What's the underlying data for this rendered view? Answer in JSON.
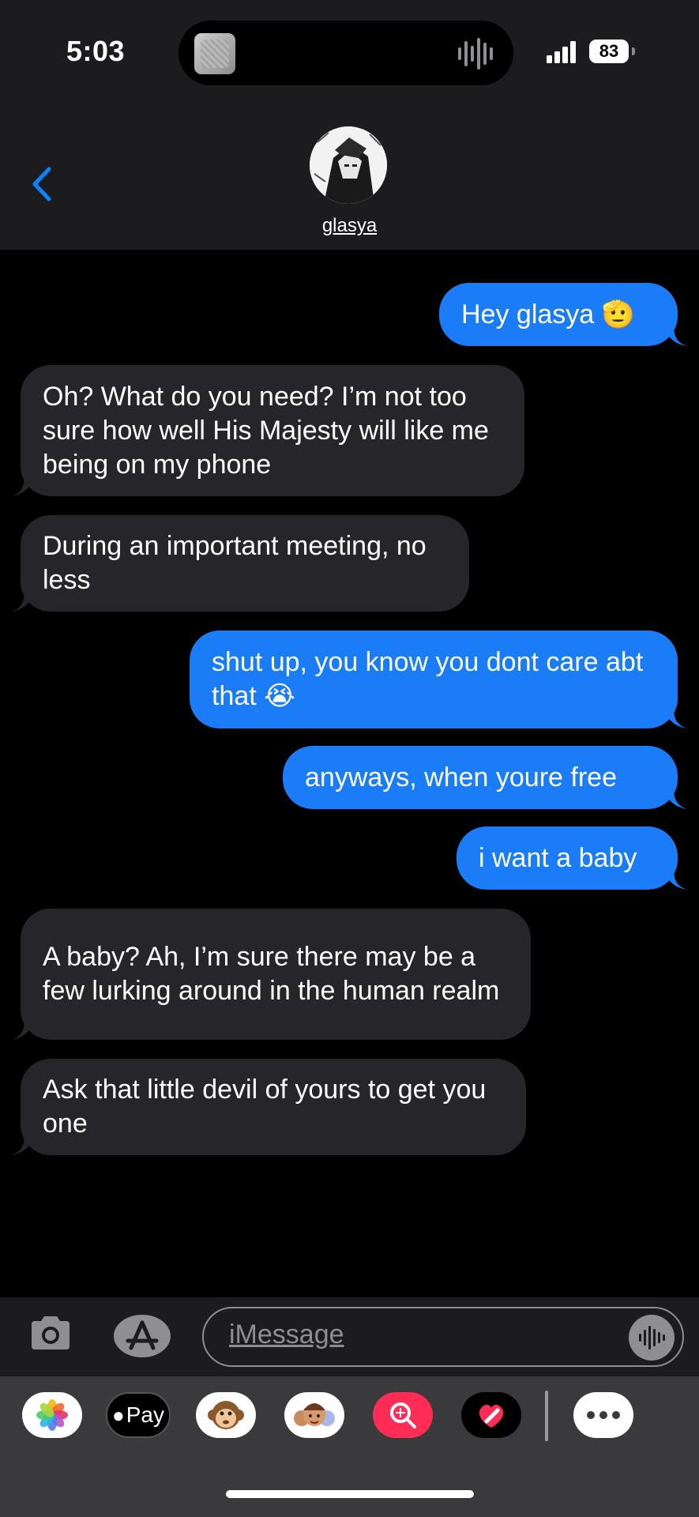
{
  "status_bar": {
    "time": "5:03",
    "battery": "83"
  },
  "contact": {
    "name": "glasya"
  },
  "messages": [
    {
      "side": "sent",
      "text": "Hey glasya 🫡"
    },
    {
      "side": "received",
      "text": "Oh? What do you need? I’m not too sure how well His Majesty will like me being on my phone"
    },
    {
      "side": "received",
      "text": "During an important meeting, no less"
    },
    {
      "side": "sent",
      "text": "shut up, you know you dont care abt that 😭"
    },
    {
      "side": "sent",
      "text": "anyways, when youre free"
    },
    {
      "side": "sent",
      "text": "i want a baby"
    },
    {
      "side": "received",
      "text": "A baby? Ah, I’m sure there may be a few lurking around in the human realm"
    },
    {
      "side": "received",
      "text": "Ask that little devil of yours to get you one"
    }
  ],
  "composer": {
    "placeholder": "iMessage"
  },
  "app_tray": {
    "apple_pay_label": "Pay",
    "apps": [
      "photos-icon",
      "apple-pay-icon",
      "animoji-icon",
      "memoji-icon",
      "image-search-icon",
      "digital-touch-icon",
      "more-icon"
    ]
  },
  "colors": {
    "sent": "#1a7cf6",
    "received": "#26262a",
    "header": "#1c1c1e",
    "back_accent": "#0a84ff"
  }
}
